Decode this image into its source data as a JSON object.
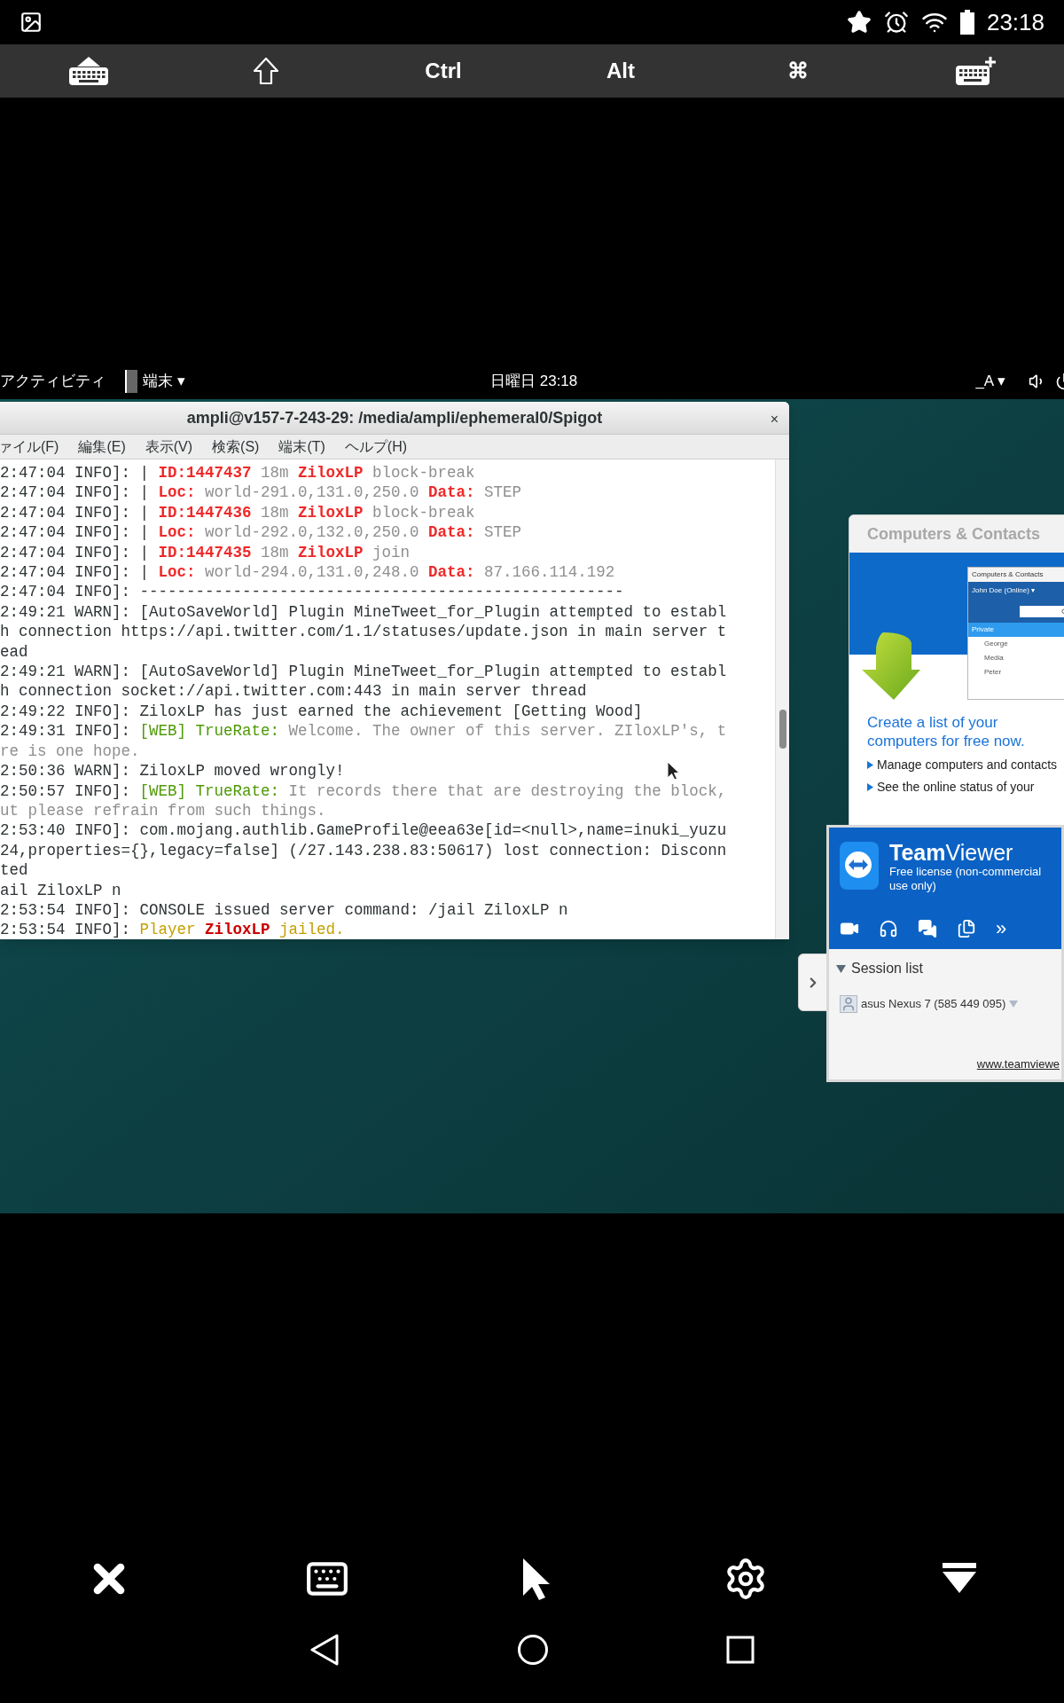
{
  "status_bar": {
    "time": "23:18"
  },
  "key_toolbar": {
    "keys": [
      {
        "kind": "keyboard-hide"
      },
      {
        "kind": "shift"
      },
      {
        "kind": "text",
        "label": "Ctrl"
      },
      {
        "kind": "text",
        "label": "Alt"
      },
      {
        "kind": "text",
        "label": "⌘"
      },
      {
        "kind": "keyboard-add"
      }
    ]
  },
  "desktop_bar": {
    "activities": "アクティビティ",
    "app_menu": "端末 ▾",
    "clock": "日曜日 23:18",
    "input_method": "_A ▾"
  },
  "terminal": {
    "title": "ampli@v157-7-243-29: /media/ampli/ephemeral0/Spigot",
    "close": "×",
    "menu": [
      "ァイル(F)",
      "編集(E)",
      "表示(V)",
      "検索(S)",
      "端末(T)",
      "ヘルプ(H)"
    ],
    "lines": [
      {
        "segments": [
          {
            "kind": "plain",
            "text": "2:47:04 INFO]: | "
          },
          {
            "kind": "alert",
            "text": "ID:1447437"
          },
          {
            "kind": "faint",
            "text": " 18m "
          },
          {
            "kind": "alert",
            "text": "ZiloxLP"
          },
          {
            "kind": "faint",
            "text": " block-break"
          }
        ]
      },
      {
        "segments": [
          {
            "kind": "plain",
            "text": "2:47:04 INFO]: | "
          },
          {
            "kind": "alert",
            "text": "Loc:"
          },
          {
            "kind": "faint",
            "text": " world-291.0,131.0,250.0 "
          },
          {
            "kind": "alert",
            "text": "Data:"
          },
          {
            "kind": "faint",
            "text": " STEP"
          }
        ]
      },
      {
        "segments": [
          {
            "kind": "plain",
            "text": "2:47:04 INFO]: | "
          },
          {
            "kind": "alert",
            "text": "ID:1447436"
          },
          {
            "kind": "faint",
            "text": " 18m "
          },
          {
            "kind": "alert",
            "text": "ZiloxLP"
          },
          {
            "kind": "faint",
            "text": " block-break"
          }
        ]
      },
      {
        "segments": [
          {
            "kind": "plain",
            "text": "2:47:04 INFO]: | "
          },
          {
            "kind": "alert",
            "text": "Loc:"
          },
          {
            "kind": "faint",
            "text": " world-292.0,132.0,250.0 "
          },
          {
            "kind": "alert",
            "text": "Data:"
          },
          {
            "kind": "faint",
            "text": " STEP"
          }
        ]
      },
      {
        "segments": [
          {
            "kind": "plain",
            "text": "2:47:04 INFO]: | "
          },
          {
            "kind": "alert",
            "text": "ID:1447435"
          },
          {
            "kind": "faint",
            "text": " 18m "
          },
          {
            "kind": "alert",
            "text": "ZiloxLP"
          },
          {
            "kind": "faint",
            "text": " join"
          }
        ]
      },
      {
        "segments": [
          {
            "kind": "plain",
            "text": "2:47:04 INFO]: | "
          },
          {
            "kind": "alert",
            "text": "Loc:"
          },
          {
            "kind": "faint",
            "text": " world-294.0,131.0,248.0 "
          },
          {
            "kind": "alert",
            "text": "Data:"
          },
          {
            "kind": "faint",
            "text": " 87.166.114.192"
          }
        ]
      },
      {
        "segments": [
          {
            "kind": "plain",
            "text": "2:47:04 INFO]: ----------------------------------------------------"
          }
        ]
      },
      {
        "segments": [
          {
            "kind": "plain",
            "text": "2:49:21 WARN]: [AutoSaveWorld] Plugin MineTweet_for_Plugin attempted to establ"
          }
        ]
      },
      {
        "segments": [
          {
            "kind": "plain",
            "text": "h connection https://api.twitter.com/1.1/statuses/update.json in main server t"
          }
        ]
      },
      {
        "segments": [
          {
            "kind": "plain",
            "text": "ead"
          }
        ]
      },
      {
        "segments": [
          {
            "kind": "plain",
            "text": "2:49:21 WARN]: [AutoSaveWorld] Plugin MineTweet_for_Plugin attempted to establ"
          }
        ]
      },
      {
        "segments": [
          {
            "kind": "plain",
            "text": "h connection socket://api.twitter.com:443 in main server thread"
          }
        ]
      },
      {
        "segments": [
          {
            "kind": "plain",
            "text": "2:49:22 INFO]: ZiloxLP has just earned the achievement [Getting Wood]"
          }
        ]
      },
      {
        "segments": [
          {
            "kind": "plain",
            "text": "2:49:31 INFO]: "
          },
          {
            "kind": "web",
            "text": "[WEB] TrueRate:"
          },
          {
            "kind": "faint",
            "text": " Welcome. The owner of this server. ZIloxLP's, t"
          }
        ]
      },
      {
        "segments": [
          {
            "kind": "faint",
            "text": "re is one hope."
          }
        ]
      },
      {
        "segments": [
          {
            "kind": "plain",
            "text": "2:50:36 WARN]: ZiloxLP moved wrongly!"
          }
        ]
      },
      {
        "segments": [
          {
            "kind": "plain",
            "text": "2:50:57 INFO]: "
          },
          {
            "kind": "web",
            "text": "[WEB] TrueRate:"
          },
          {
            "kind": "faint",
            "text": " It records there that are destroying the block,"
          }
        ]
      },
      {
        "segments": [
          {
            "kind": "faint",
            "text": "ut please refrain from such things."
          }
        ]
      },
      {
        "segments": [
          {
            "kind": "plain",
            "text": "2:53:40 INFO]: com.mojang.authlib.GameProfile@eea63e[id=<null>,name=inuki_yuzu"
          }
        ]
      },
      {
        "segments": [
          {
            "kind": "plain",
            "text": "24,properties={},legacy=false] (/27.143.238.83:50617) lost connection: Disconn"
          }
        ]
      },
      {
        "segments": [
          {
            "kind": "plain",
            "text": "ted"
          }
        ]
      },
      {
        "segments": [
          {
            "kind": "plain",
            "text": "ail ZiloxLP n"
          }
        ]
      },
      {
        "segments": [
          {
            "kind": "plain",
            "text": "2:53:54 INFO]: CONSOLE issued server command: /jail ZiloxLP n"
          }
        ]
      },
      {
        "segments": [
          {
            "kind": "plain",
            "text": "2:53:54 INFO]: "
          },
          {
            "kind": "notice",
            "text": "Player "
          },
          {
            "kind": "name",
            "text": "ZiloxLP"
          },
          {
            "kind": "notice",
            "text": " jailed."
          }
        ]
      }
    ]
  },
  "contacts_panel": {
    "title": "Computers & Contacts",
    "preview": {
      "title": "Computers & Contacts",
      "account": "John Doe (Online) ▾",
      "items": [
        {
          "label": "Private",
          "selected": true
        },
        {
          "label": "George",
          "selected": false
        },
        {
          "label": "Media",
          "selected": false
        },
        {
          "label": "Peter",
          "selected": false
        }
      ]
    },
    "headline": "Create a list of your computers for free now.",
    "bullets": [
      "Manage computers and contacts",
      "See the online status of your"
    ]
  },
  "teamviewer": {
    "brand_bold": "Team",
    "brand_rest": "Viewer",
    "license": "Free license (non-commercial use only)",
    "more": "»",
    "session_list": {
      "title": "Session list",
      "expanded": true,
      "sessions": [
        "asus Nexus 7 (585 449 095)"
      ]
    },
    "link": "www.teamviewe"
  }
}
